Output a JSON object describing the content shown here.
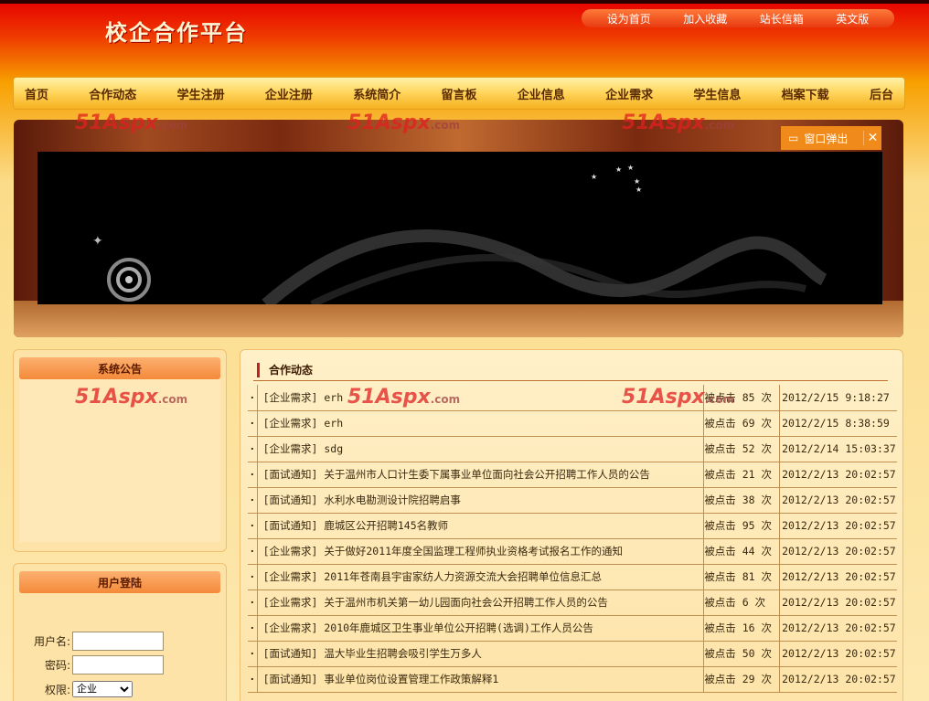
{
  "header": {
    "site_title": "校企合作平台"
  },
  "top_links": [
    "设为首页",
    "加入收藏",
    "站长信箱",
    "英文版"
  ],
  "nav": [
    "首页",
    "合作动态",
    "学生注册",
    "企业注册",
    "系统简介",
    "留言板",
    "企业信息",
    "企业需求",
    "学生信息",
    "档案下载",
    "后台"
  ],
  "banner": {
    "popup_label": "窗口弹出",
    "close_glyph": "✕"
  },
  "watermark": {
    "main": "51Aspx",
    "suffix": ".com"
  },
  "notice": {
    "title": "系统公告"
  },
  "login": {
    "title": "用户登陆",
    "username_label": "用户名:",
    "password_label": "密码:",
    "role_label": "权限:",
    "role_selected": "企业"
  },
  "news": {
    "title": "合作动态",
    "items": [
      {
        "title": "[企业需求] erh",
        "clicks": "被点击 85 次",
        "time": "2012/2/15 9:18:27"
      },
      {
        "title": "[企业需求] erh",
        "clicks": "被点击 69 次",
        "time": "2012/2/15 8:38:59"
      },
      {
        "title": "[企业需求] sdg",
        "clicks": "被点击 52 次",
        "time": "2012/2/14 15:03:37"
      },
      {
        "title": "[面试通知] 关于温州市人口计生委下属事业单位面向社会公开招聘工作人员的公告",
        "clicks": "被点击 21 次",
        "time": "2012/2/13 20:02:57"
      },
      {
        "title": "[面试通知] 水利水电勘测设计院招聘启事",
        "clicks": "被点击 38 次",
        "time": "2012/2/13 20:02:57"
      },
      {
        "title": "[面试通知] 鹿城区公开招聘145名教师",
        "clicks": "被点击 95 次",
        "time": "2012/2/13 20:02:57"
      },
      {
        "title": "[企业需求] 关于做好2011年度全国监理工程师执业资格考试报名工作的通知",
        "clicks": "被点击 44 次",
        "time": "2012/2/13 20:02:57"
      },
      {
        "title": "[企业需求] 2011年苍南县宇宙家纺人力资源交流大会招聘单位信息汇总",
        "clicks": "被点击 81 次",
        "time": "2012/2/13 20:02:57"
      },
      {
        "title": "[企业需求] 关于温州市机关第一幼儿园面向社会公开招聘工作人员的公告",
        "clicks": "被点击 6 次",
        "time": "2012/2/13 20:02:57"
      },
      {
        "title": "[企业需求] 2010年鹿城区卫生事业单位公开招聘(选调)工作人员公告",
        "clicks": "被点击 16 次",
        "time": "2012/2/13 20:02:57"
      },
      {
        "title": "[面试通知] 温大毕业生招聘会吸引学生万多人",
        "clicks": "被点击 50 次",
        "time": "2012/2/13 20:02:57"
      },
      {
        "title": "[面试通知] 事业单位岗位设置管理工作政策解释1",
        "clicks": "被点击 29 次",
        "time": "2012/2/13 20:02:57"
      }
    ]
  }
}
